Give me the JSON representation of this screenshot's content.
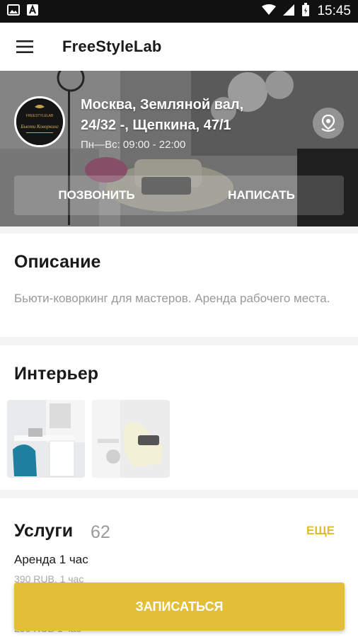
{
  "status_bar": {
    "time": "15:45",
    "icons": [
      "image-icon",
      "a-icon",
      "wifi-icon",
      "signal-icon",
      "battery-icon"
    ]
  },
  "app_bar": {
    "title": "FreeStyleLab",
    "menu_icon": "hamburger-menu-icon"
  },
  "hero": {
    "address": "Москва, Земляной вал, 24/32 -, Щепкина, 47/1",
    "hours": "Пн—Вс: 09:00 - 22:00",
    "call_label": "ПОЗВОНИТЬ",
    "write_label": "НАПИСАТЬ",
    "map_icon": "map-pin-icon",
    "logo_text_top": "FREESTYLELAB",
    "logo_text_main": "Бьюти Коворкинг"
  },
  "description": {
    "title": "Описание",
    "text": "Бьюти-коворкинг для мастеров. Аренда рабочего места."
  },
  "interior": {
    "title": "Интерьер",
    "photos": [
      "interior-photo-1",
      "interior-photo-2"
    ]
  },
  "services": {
    "title": "Услуги",
    "count": "62",
    "more_label": "ЕЩЕ",
    "items": [
      {
        "name": "Аренда 1 час",
        "price": "390 RUB, 1 час"
      },
      {
        "name": "",
        "price": "290 RUB  1 час"
      }
    ]
  },
  "book_button": {
    "label": "ЗАПИСАТЬСЯ"
  },
  "colors": {
    "accent": "#e3bf37",
    "more_text": "#e0bd2a",
    "status_bar": "#111111"
  }
}
